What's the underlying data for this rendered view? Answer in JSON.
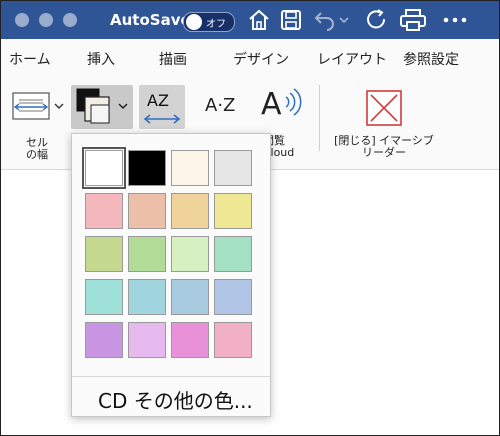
{
  "titlebar": {
    "autosave_label": "AutoSave",
    "toggle_state": "オフ",
    "bg_color": "#2f5597"
  },
  "tabs": [
    "ホーム",
    "挿入",
    "描画",
    "デザイン",
    "レイアウト",
    "参照設定"
  ],
  "ribbon": {
    "column_width": {
      "line1": "セル",
      "line2": "の幅"
    },
    "read_aloud": {
      "line1": "閲覧",
      "line2": "Aloud"
    },
    "close_immersive": {
      "line1": "[閉じる] イマーシブ",
      "line2": "リーダー"
    },
    "sort_az_label": "AZ",
    "sort_az2_label": "A·Z",
    "read_aloud_icon_letter": "A"
  },
  "color_popup": {
    "swatches": [
      "#ffffff",
      "#000000",
      "#fdf5e8",
      "#e6e6e6",
      "#f4b8bc",
      "#ebbfa8",
      "#efd39a",
      "#eee894",
      "#c4d890",
      "#b1db96",
      "#d6f0c2",
      "#a4e0c4",
      "#9edfd8",
      "#a0d4de",
      "#a8cbe0",
      "#b1c6e6",
      "#c896e2",
      "#e6baee",
      "#e890d8",
      "#f2b0c6"
    ],
    "selected_index": 0,
    "more_colors_label": "CD その他の色..."
  }
}
